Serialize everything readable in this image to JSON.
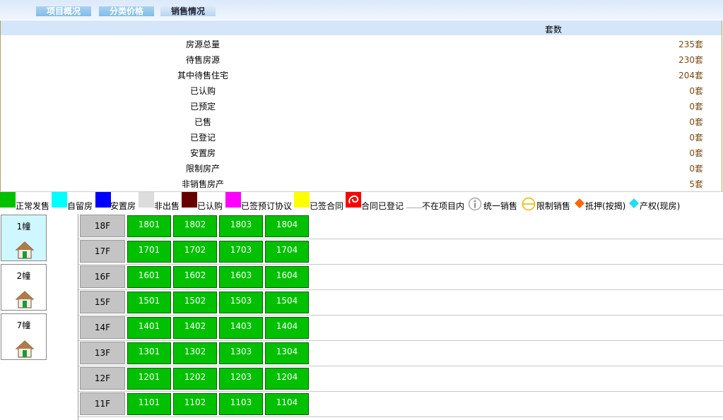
{
  "tabs": [
    {
      "label": "项目概况"
    },
    {
      "label": "分类价格"
    },
    {
      "label": "销售情况"
    }
  ],
  "summary": {
    "header": "套数",
    "rows": [
      {
        "label": "房源总量",
        "value": "235套"
      },
      {
        "label": "待售房源",
        "value": "230套"
      },
      {
        "label": "其中待售住宅",
        "value": "204套"
      },
      {
        "label": "已认购",
        "value": "0套"
      },
      {
        "label": "已预定",
        "value": "0套"
      },
      {
        "label": "已售",
        "value": "0套"
      },
      {
        "label": "已登记",
        "value": "0套"
      },
      {
        "label": "安置房",
        "value": "0套"
      },
      {
        "label": "限制房产",
        "value": "0套"
      },
      {
        "label": "非销售房产",
        "value": "5套"
      }
    ]
  },
  "legend": [
    {
      "label": "正常发售",
      "color": "#00c000"
    },
    {
      "label": "自留房",
      "color": "#00ffff"
    },
    {
      "label": "安置房",
      "color": "#0000ff"
    },
    {
      "label": "非出售",
      "color": "#dcdcdc"
    },
    {
      "label": "已认购",
      "color": "#660000"
    },
    {
      "label": "已签预订协议",
      "color": "#ff00ff"
    },
    {
      "label": "已签合同",
      "color": "#ffff00"
    },
    {
      "label": "合同已登记",
      "color": "#ff0000"
    },
    {
      "label": "不在项目内",
      "color": "#ffffff"
    },
    {
      "label": "统一销售",
      "icon": "info-circle-icon"
    },
    {
      "label": "限制销售",
      "icon": "restricted-circle-icon"
    },
    {
      "label": "抵押(按揭)",
      "icon": "orange-diamond-icon",
      "color": "#ff6600"
    },
    {
      "label": "产权(现房)",
      "icon": "cyan-diamond-icon",
      "color": "#22ddee"
    }
  ],
  "buildings": [
    {
      "name": "1幢",
      "selected": true
    },
    {
      "name": "2幢",
      "selected": false
    },
    {
      "name": "7幢",
      "selected": false
    }
  ],
  "floors": [
    {
      "label": "18F",
      "units": [
        "1801",
        "1802",
        "1803",
        "1804"
      ]
    },
    {
      "label": "17F",
      "units": [
        "1701",
        "1702",
        "1703",
        "1704"
      ]
    },
    {
      "label": "16F",
      "units": [
        "1601",
        "1602",
        "1603",
        "1604"
      ]
    },
    {
      "label": "15F",
      "units": [
        "1501",
        "1502",
        "1503",
        "1504"
      ]
    },
    {
      "label": "14F",
      "units": [
        "1401",
        "1402",
        "1403",
        "1404"
      ]
    },
    {
      "label": "13F",
      "units": [
        "1301",
        "1302",
        "1303",
        "1304"
      ]
    },
    {
      "label": "12F",
      "units": [
        "1201",
        "1202",
        "1203",
        "1204"
      ]
    },
    {
      "label": "11F",
      "units": [
        "1101",
        "1102",
        "1103",
        "1104"
      ]
    }
  ]
}
